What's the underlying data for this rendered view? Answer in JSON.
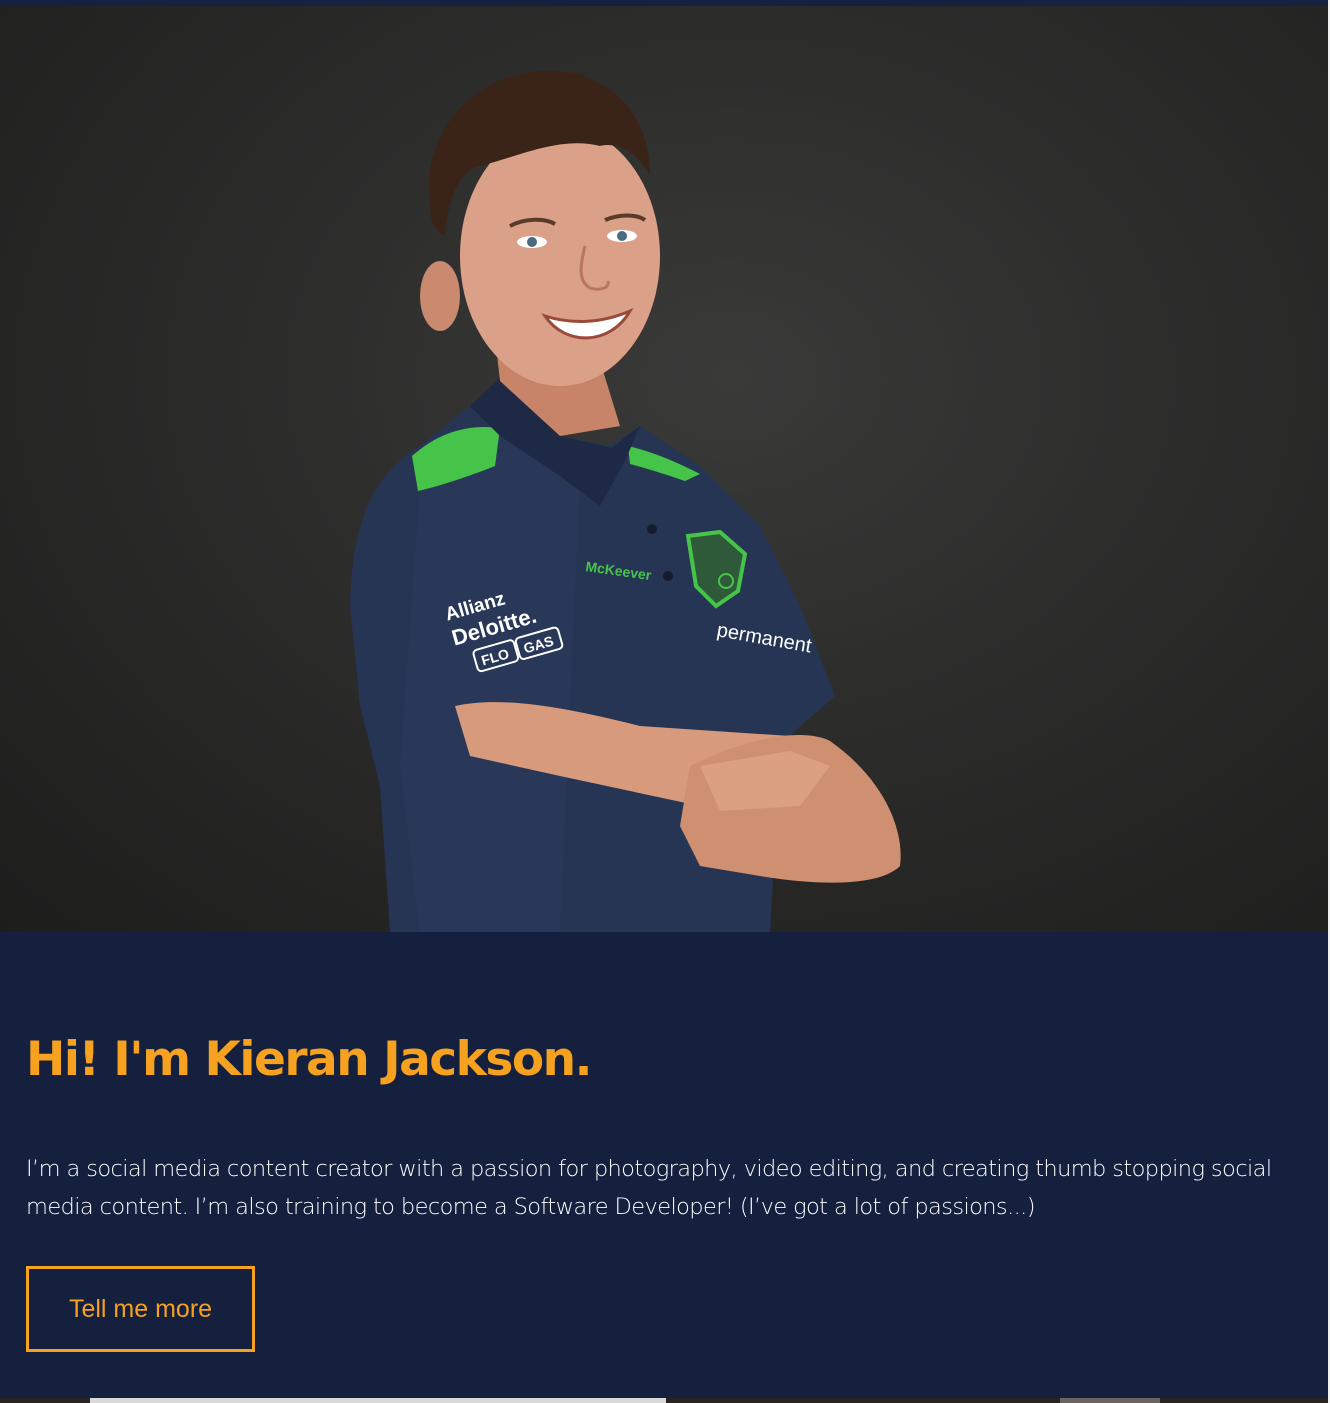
{
  "hero": {
    "photo_alt": "Kieran Jackson portrait",
    "shirt_sponsor_sleeve_1": "Allianz",
    "shirt_sponsor_sleeve_2": "Deloitte.",
    "shirt_sponsor_sleeve_3": "FLO",
    "shirt_sponsor_sleeve_4": "GAS",
    "shirt_brand": "McKeever",
    "shirt_sponsor_chest": "permanent"
  },
  "intro": {
    "headline": "Hi! I'm Kieran Jackson.",
    "bio": "I’m a social media content creator with a passion for photography, video editing, and creating thumb stopping social media content. I’m also training to become a Software Developer! (I’ve got a lot of passions...)",
    "cta_label": "Tell me more"
  },
  "colors": {
    "accent": "#f6a11f",
    "navy": "#14203d",
    "backdrop": "#2c2c2b"
  }
}
